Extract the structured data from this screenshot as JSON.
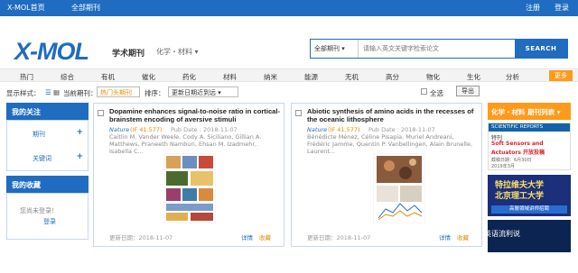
{
  "topbar": {
    "home": "X-MOL首页",
    "all_journals": "全部期刊",
    "register": "注册",
    "login": "登录"
  },
  "logo": {
    "brand": "X-MOL",
    "subtitle": "学术期刊",
    "category": "化学・材料"
  },
  "search": {
    "scope": "全部期刊",
    "placeholder": "请输入英文关键字检索论文",
    "button": "SEARCH"
  },
  "nav": {
    "items": [
      "热门",
      "综合",
      "有机",
      "催化",
      "药化",
      "材料",
      "纳米",
      "能源",
      "无机",
      "高分",
      "物化",
      "生化",
      "分析"
    ],
    "more": "更多"
  },
  "toolbar": {
    "display_label": "显示样式：",
    "current_label": "当前期刊：",
    "current_value": "热门头期刊",
    "sort_label": "排序：",
    "sort_value": "更新日期近到远",
    "select_all": "全选",
    "export": "导出"
  },
  "sidebar": {
    "follow_title": "我的关注",
    "follow_journal": "期刊",
    "follow_keyword": "关键词",
    "fav_title": "我的收藏",
    "fav_hint": "您尚未登录！",
    "fav_login": "登录"
  },
  "cards": [
    {
      "title": "Dopamine enhances signal-to-noise ratio in cortical-brainstem encoding of aversive stimuli",
      "journal": "Nature",
      "impact": "(IF 41.577)",
      "pub_date": "Pub Date : 2018-11-07",
      "authors": "Caitlin M. Vander Weele, Cody A. Siciliano, Gillian A. Matthews, Praneeth Namburi, Ehsan M. Izadmehr, Isabella C...",
      "update": "更新日期：2018-11-07",
      "detail": "详情",
      "fav": "收藏"
    },
    {
      "title": "Abiotic synthesis of amino acids in the recesses of the oceanic lithosphere",
      "journal": "Nature",
      "impact": "(IF 41.577)",
      "pub_date": "Pub Date : 2018-11-07",
      "authors": "Bénédicte Ménez, Céline Pisapia, Muriel Andreani, Frédéric Jamme, Quentin P. Vanbellingen, Alain Brunelle, Laurent...",
      "update": "更新日期：2018-11-07",
      "detail": "详情",
      "fav": "收藏"
    }
  ],
  "right": {
    "head": "化学・材料 期刊列表",
    "ad1": {
      "brand": "SCIENTIFIC REPORTS",
      "l1": "特刊",
      "l2": "Soft Sensors and",
      "l3": "Actuators 开放投稿",
      "l4": "截稿日期：6月30日",
      "l5": "2019年3月"
    },
    "ad2": {
      "a": "特拉维夫大学",
      "b": "北京理工大学",
      "c": "高層領域讲师招聘"
    },
    "watermark": "英语流利说"
  },
  "colors": {
    "primary": "#1f6cc0",
    "accent": "#ff9a1a"
  }
}
